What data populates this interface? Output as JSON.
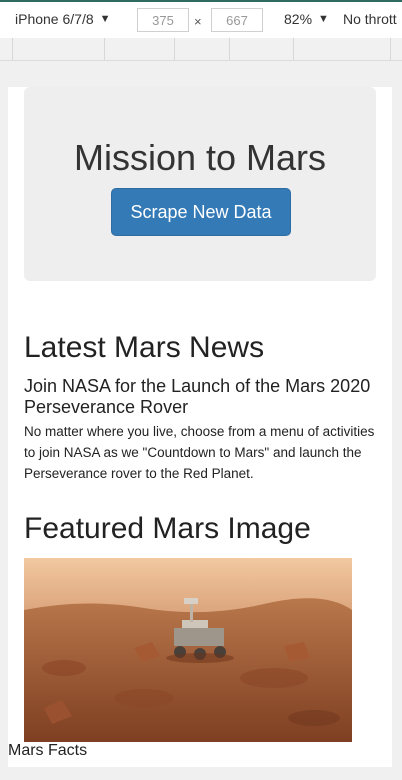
{
  "devtools": {
    "device": "iPhone 6/7/8",
    "width": "375",
    "height": "667",
    "times": "×",
    "zoom": "82%",
    "throttle": "No thrott",
    "caret": "▼"
  },
  "page": {
    "jumbotron_title": "Mission to Mars",
    "scrape_button": "Scrape New Data",
    "news_section_title": "Latest Mars News",
    "news_headline": "Join NASA for the Launch of the Mars 2020 Perseverance Rover",
    "news_teaser": "No matter where you live, choose from a menu of activities to join NASA as we \"Countdown to Mars\" and launch the Perseverance rover to the Red Planet.",
    "featured_section_title": "Featured Mars Image",
    "facts_title": "Mars Facts"
  },
  "colors": {
    "button": "#337ab7",
    "jumbotron": "#eeeeee",
    "devtools_accent": "#2f6b5e"
  }
}
